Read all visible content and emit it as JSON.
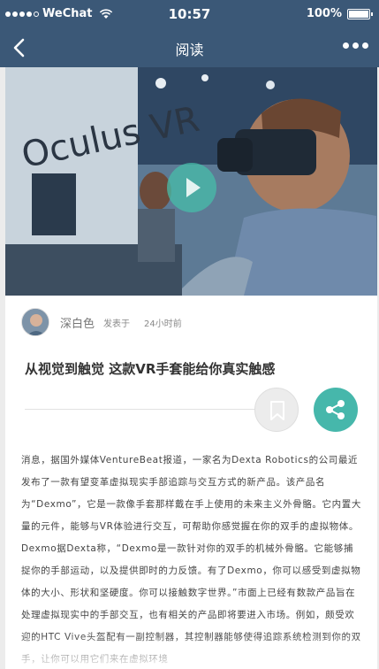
{
  "status_bar": {
    "carrier": "WeChat",
    "time": "10:57",
    "battery": "100%"
  },
  "nav": {
    "title": "阅读"
  },
  "article": {
    "author": "深白色",
    "posted_label": "发表于",
    "posted_time": "24小时前",
    "title": "从视觉到触觉 这款VR手套能给你真实触感",
    "body": "消息，据国外媒体VentureBeat报道，一家名为Dexta Robotics的公司最近发布了一款有望变革虚拟现实手部追踪与交互方式的新产品。该产品名为“Dexmo”，它是一款像手套那样戴在手上使用的未来主义外骨骼。它内置大量的元件，能够与VR体验进行交互，可帮助你感觉握在你的双手的虚拟物体。Dexmo据Dexta称，“Dexmo是一款针对你的双手的机械外骨骼。它能够捕捉你的手部运动，以及提供即时的力反馈。有了Dexmo，你可以感受到虚拟物体的大小、形状和坚硬度。你可以接触数字世界。”市面上已经有数款产品旨在处理虚拟现实中的手部交互，也有相关的产品即将要进入市场。例如，颇受欢迎的HTC Vive头盔配有一副控制器，其控制器能够使得追踪系统检测到你的双手，让你可以用它们来在虚拟环境"
  },
  "colors": {
    "header_bg": "#3b5877",
    "accent": "#46b7ab"
  },
  "icons": {
    "back": "chevron-left-icon",
    "more": "more-dots-icon",
    "play": "play-icon",
    "bookmark": "bookmark-icon",
    "share": "share-icon"
  }
}
